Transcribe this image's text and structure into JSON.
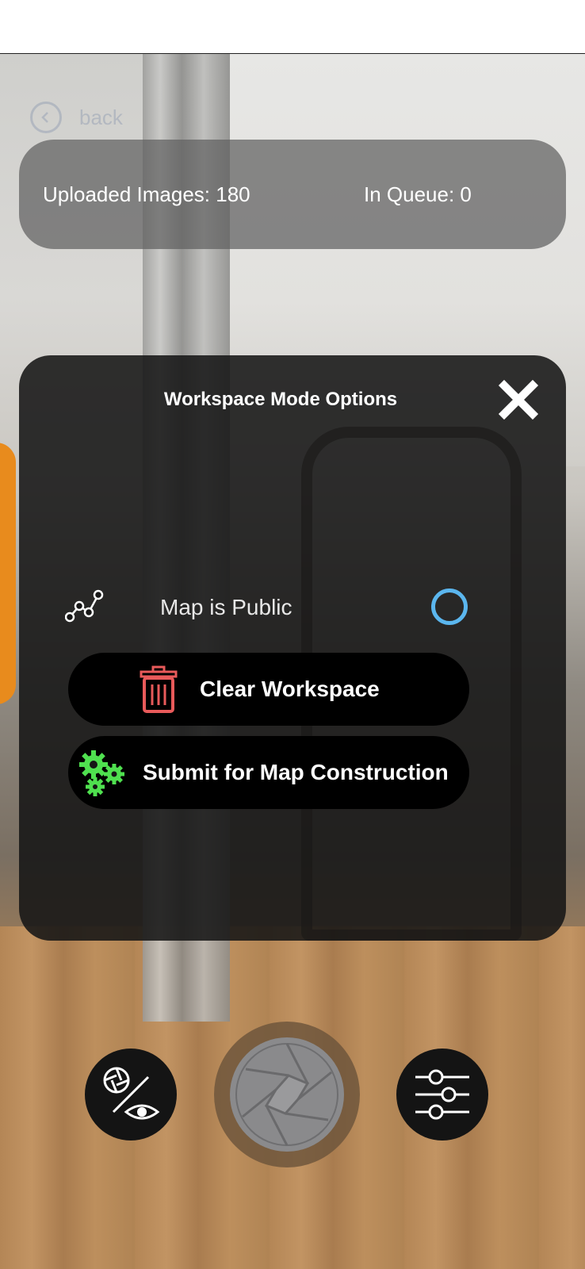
{
  "nav": {
    "back_label": "back"
  },
  "stats": {
    "uploaded_label": "Uploaded Images: 180",
    "queue_label": "In Queue: 0"
  },
  "options": {
    "title": "Workspace Mode Options",
    "public_label": "Map is Public",
    "public_enabled": false,
    "clear_label": "Clear Workspace",
    "submit_label": "Submit for Map Construction"
  },
  "icons": {
    "close": "close-icon",
    "route": "route-icon",
    "trash": "trash-icon",
    "gears": "gears-icon",
    "mode": "camera-eye-toggle-icon",
    "shutter": "shutter-icon",
    "settings": "sliders-icon"
  },
  "colors": {
    "toggle": "#5bb6ee",
    "trash": "#e85a5a",
    "gears": "#4fe04f"
  }
}
